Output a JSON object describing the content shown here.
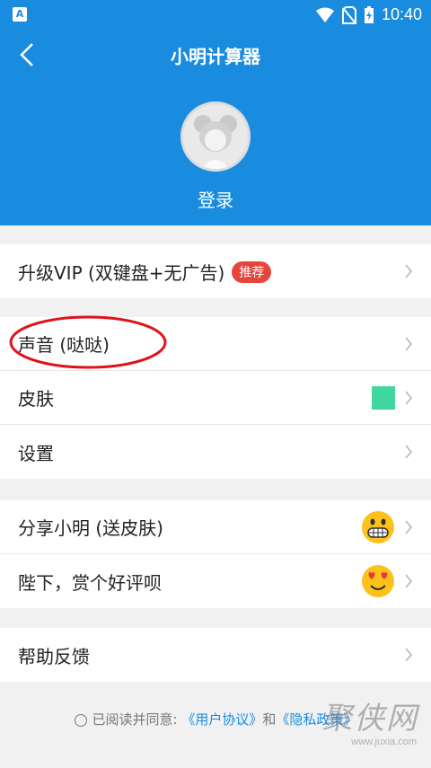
{
  "status_bar": {
    "time": "10:40"
  },
  "header": {
    "title": "小明计算器",
    "login_label": "登录"
  },
  "groups": [
    {
      "rows": [
        {
          "label": "升级VIP (双键盘+无广告)",
          "badge": "推荐"
        }
      ]
    },
    {
      "rows": [
        {
          "label": "声音 (哒哒)"
        },
        {
          "label": "皮肤",
          "swatch_color": "#3fd6a0"
        },
        {
          "label": "设置"
        }
      ]
    },
    {
      "rows": [
        {
          "label": "分享小明 (送皮肤)",
          "icon": "grinning-face-icon"
        },
        {
          "label": "陛下，赏个好评呗",
          "icon": "heart-eyes-face-icon"
        }
      ]
    },
    {
      "rows": [
        {
          "label": "帮助反馈"
        }
      ]
    }
  ],
  "footer": {
    "prefix": "已阅读并同意:",
    "user_agreement": "《用户协议》",
    "conjunction": "和",
    "privacy_policy": "《隐私政策》"
  },
  "watermark": {
    "text": "聚侠网",
    "url": "www.juxia.com"
  },
  "colors": {
    "primary": "#1a8ce0",
    "badge": "#e5453b",
    "highlight": "#e0111b"
  }
}
